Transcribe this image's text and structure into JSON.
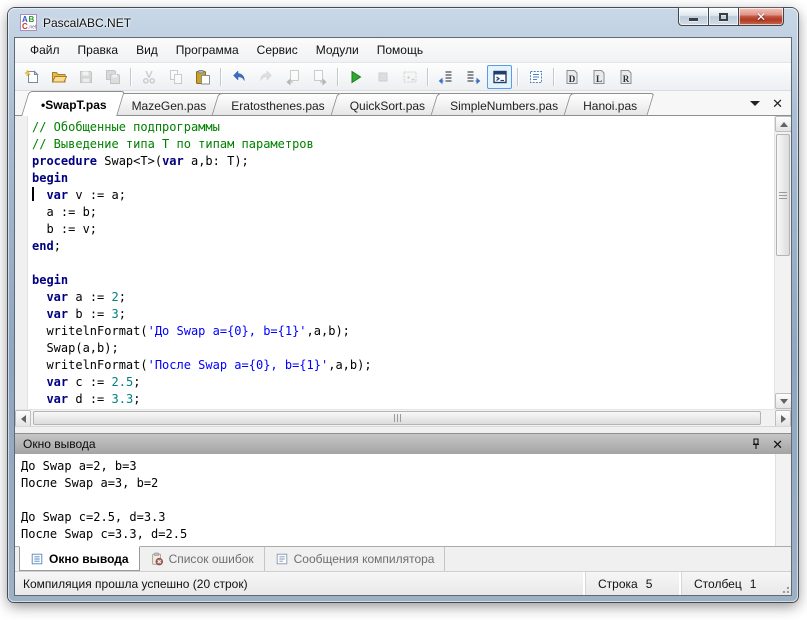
{
  "window": {
    "title": "PascalABC.NET"
  },
  "menu": {
    "items": [
      {
        "key": "file",
        "label": "Файл"
      },
      {
        "key": "edit",
        "label": "Правка"
      },
      {
        "key": "view",
        "label": "Вид"
      },
      {
        "key": "program",
        "label": "Программа"
      },
      {
        "key": "service",
        "label": "Сервис"
      },
      {
        "key": "modules",
        "label": "Модули"
      },
      {
        "key": "help",
        "label": "Помощь"
      }
    ]
  },
  "toolbar": {
    "items": [
      {
        "key": "new-file"
      },
      {
        "key": "open-file"
      },
      {
        "key": "save",
        "state": "disabled"
      },
      {
        "key": "save-all",
        "state": "disabled"
      },
      {
        "sep": true
      },
      {
        "key": "cut",
        "state": "disabled"
      },
      {
        "key": "copy",
        "state": "disabled"
      },
      {
        "key": "paste"
      },
      {
        "sep": true
      },
      {
        "key": "undo"
      },
      {
        "key": "redo",
        "state": "disabled"
      },
      {
        "key": "prev-page",
        "state": "disabled"
      },
      {
        "key": "next-page",
        "state": "disabled"
      },
      {
        "sep": true
      },
      {
        "key": "run"
      },
      {
        "key": "stop",
        "state": "disabled"
      },
      {
        "key": "build",
        "state": "disabled"
      },
      {
        "sep": true
      },
      {
        "key": "goto-prev-position"
      },
      {
        "key": "goto-next-position"
      },
      {
        "key": "show-console",
        "state": "selected"
      },
      {
        "sep": true
      },
      {
        "key": "code-structure"
      },
      {
        "sep": true
      },
      {
        "key": "doc-d"
      },
      {
        "key": "doc-l"
      },
      {
        "key": "doc-r"
      }
    ]
  },
  "tabs": {
    "items": [
      {
        "key": "swapt",
        "label": "•SwapT.pas",
        "active": true
      },
      {
        "key": "mazegen",
        "label": "MazeGen.pas"
      },
      {
        "key": "eratosthenes",
        "label": "Eratosthenes.pas"
      },
      {
        "key": "quicksort",
        "label": "QuickSort.pas"
      },
      {
        "key": "simplenumbers",
        "label": "SimpleNumbers.pas"
      },
      {
        "key": "hanoi",
        "label": "Hanoi.pas"
      }
    ]
  },
  "editor": {
    "caret_line": 5,
    "lines": [
      [
        [
          "cm",
          "// Обобщенные подпрограммы"
        ]
      ],
      [
        [
          "cm",
          "// Выведение типа T по типам параметров"
        ]
      ],
      [
        [
          "kw",
          "procedure"
        ],
        [
          "pl",
          " Swap<T>("
        ],
        [
          "kw",
          "var"
        ],
        [
          "pl",
          " a,b: T);"
        ]
      ],
      [
        [
          "kw",
          "begin"
        ]
      ],
      [
        [
          "pl",
          "  "
        ],
        [
          "kw",
          "var"
        ],
        [
          "pl",
          " v := a;"
        ]
      ],
      [
        [
          "pl",
          "  a := b;"
        ]
      ],
      [
        [
          "pl",
          "  b := v;"
        ]
      ],
      [
        [
          "kw",
          "end"
        ],
        [
          "pl",
          ";"
        ]
      ],
      [],
      [
        [
          "kw",
          "begin"
        ]
      ],
      [
        [
          "pl",
          "  "
        ],
        [
          "kw",
          "var"
        ],
        [
          "pl",
          " a := "
        ],
        [
          "num",
          "2"
        ],
        [
          "pl",
          ";"
        ]
      ],
      [
        [
          "pl",
          "  "
        ],
        [
          "kw",
          "var"
        ],
        [
          "pl",
          " b := "
        ],
        [
          "num",
          "3"
        ],
        [
          "pl",
          ";"
        ]
      ],
      [
        [
          "pl",
          "  writelnFormat("
        ],
        [
          "str",
          "'До Swap a={0}, b={1}'"
        ],
        [
          "pl",
          ",a,b);"
        ]
      ],
      [
        [
          "pl",
          "  Swap(a,b);"
        ]
      ],
      [
        [
          "pl",
          "  writelnFormat("
        ],
        [
          "str",
          "'После Swap a={0}, b={1}'"
        ],
        [
          "pl",
          ",a,b);"
        ]
      ],
      [
        [
          "pl",
          "  "
        ],
        [
          "kw",
          "var"
        ],
        [
          "pl",
          " c := "
        ],
        [
          "num",
          "2.5"
        ],
        [
          "pl",
          ";"
        ]
      ],
      [
        [
          "pl",
          "  "
        ],
        [
          "kw",
          "var"
        ],
        [
          "pl",
          " d := "
        ],
        [
          "num",
          "3.3"
        ],
        [
          "pl",
          ";"
        ]
      ]
    ]
  },
  "output_panel": {
    "title": "Окно вывода",
    "lines": [
      "До Swap a=2, b=3",
      "После Swap a=3, b=2",
      "",
      "До Swap c=2.5, d=3.3",
      "После Swap c=3.3, d=2.5"
    ]
  },
  "bottom_tabs": {
    "items": [
      {
        "key": "output",
        "icon": "output-icon",
        "label": "Окно вывода",
        "active": true
      },
      {
        "key": "errors",
        "icon": "errors-icon",
        "label": "Список ошибок"
      },
      {
        "key": "compiler-messages",
        "icon": "messages-icon",
        "label": "Сообщения компилятора"
      }
    ]
  },
  "status_bar": {
    "message": "Компиляция прошла успешно (20 строк)",
    "line_label": "Строка",
    "line_value": "5",
    "col_label": "Столбец",
    "col_value": "1"
  },
  "colors": {
    "keyword": "#000080",
    "comment": "#008000",
    "string": "#0000ff",
    "number": "#008080",
    "selection_border": "#569de5"
  }
}
